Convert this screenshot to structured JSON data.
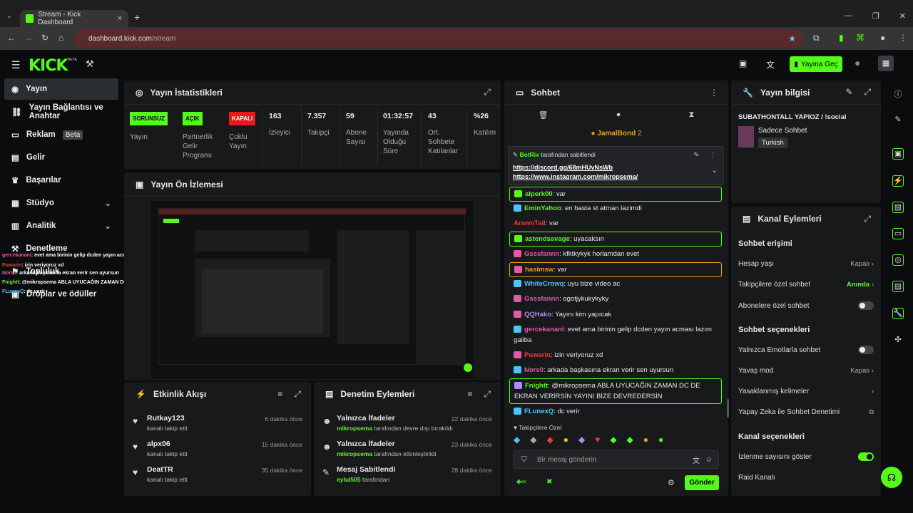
{
  "browser": {
    "tab_title": "Stream - Kick Dashboard",
    "url_host": "dashboard.kick.com",
    "url_path": "/stream"
  },
  "topbar": {
    "logo": "KICK",
    "beta": "BETA",
    "go_live": "Yayına Geç"
  },
  "sidebar": {
    "items": [
      {
        "label": "Yayın"
      },
      {
        "label": "Yayın Bağlantısı ve Anahtar"
      },
      {
        "label": "Reklam",
        "badge": "Beta"
      },
      {
        "label": "Gelir"
      },
      {
        "label": "Başarılar"
      },
      {
        "label": "Stüdyo"
      },
      {
        "label": "Analitik"
      },
      {
        "label": "Denetleme"
      },
      {
        "label": "Topluluk"
      },
      {
        "label": "Droplar ve ödüller"
      }
    ],
    "overlay_chat": [
      {
        "user": "gercekanani",
        "text": ": evet ama birinin gelip dcden yayın acması lazım galiba"
      },
      {
        "user": "Puwarin",
        "text": ": izin veriyoruz xd"
      },
      {
        "user": "Nors0",
        "text": ": arkada başkasına ekran verir sen uyursun"
      },
      {
        "user": "Fnightt",
        "text": ": @mikropsema ABLA UYUCAĞIN ZAMAN DC DE EKRAN VERİRSİN YAYINI BİZE DEVREDERSİN"
      },
      {
        "user": "FLunexQ",
        "text": ": dc verir"
      }
    ]
  },
  "stats": {
    "title": "Yayın İstatistikleri",
    "items": [
      {
        "pill": "SORUNSUZ",
        "label": "Yayın"
      },
      {
        "pill": "AÇIK",
        "label": "Partnerlik Gelir Programı"
      },
      {
        "pill": "KAPALI",
        "label": "Çoklu Yayın"
      },
      {
        "value": "163",
        "label": "İzleyici"
      },
      {
        "value": "7.357",
        "label": "Takipçi"
      },
      {
        "value": "59",
        "label": "Abone Sayısı"
      },
      {
        "value": "01:32:57",
        "label": "Yayında Olduğu Süre"
      },
      {
        "value": "43",
        "label": "Ort. Sohbete Katılanlar"
      },
      {
        "value": "%26",
        "label": "Katılım"
      }
    ]
  },
  "preview": {
    "title": "Yayın Ön İzlemesi"
  },
  "activity": {
    "title": "Etkinlik Akışı",
    "items": [
      {
        "name": "Rutkay123",
        "sub": "kanalı takip etti",
        "time": "6 dakika önce"
      },
      {
        "name": "alpx06",
        "sub": "kanalı takip etti",
        "time": "15 dakika önce"
      },
      {
        "name": "DeatTR",
        "sub": "kanalı takip etti",
        "time": "35 dakika önce"
      }
    ]
  },
  "moderation": {
    "title": "Denetim Eylemleri",
    "items": [
      {
        "name": "Yalnızca İfadeler",
        "actor": "mikropsema",
        "sub": " tarafından devre dışı bırakıldı",
        "time": "22 dakika önce"
      },
      {
        "name": "Yalnızca İfadeler",
        "actor": "mikropsema",
        "sub": " tarafından etkinleştirildi",
        "time": "23 dakika önce"
      },
      {
        "name": "Mesaj Sabitlendi",
        "actor": "eylul505",
        "sub": " tarafından",
        "time": "28 dakika önce"
      }
    ]
  },
  "chat": {
    "title": "Sohbet",
    "top_gifter": "JamalBond",
    "top_gifter_count": "2",
    "pinned_by": "BotRix",
    "pinned_suffix": "tarafından sabitlendi",
    "pinned_links": [
      "https://discord.gg/68mHUvNsWb",
      "https://www.instagram.com/mikropsema/"
    ],
    "messages": [
      {
        "user": "alperk00",
        "text": ": var",
        "color": "#53fc18"
      },
      {
        "user": "EminYahoo",
        "text": ": en basta st atman lazimdi",
        "color": "#53fc18"
      },
      {
        "user": "ArawnTail",
        "text": ": var",
        "color": "#e93c3c"
      },
      {
        "user": "astendsavage",
        "text": ": uyacaksın",
        "color": "#53fc18"
      },
      {
        "user": "Gsssfannn",
        "text": ": kfktkykyk horlamdan evet",
        "color": "#e05aa8"
      },
      {
        "user": "hasimsw",
        "text": ": var",
        "color": "#e8a01a"
      },
      {
        "user": "WhiteCrowq",
        "text": ": uyu bize video ac",
        "color": "#4fc3f7"
      },
      {
        "user": "Gsssfannn",
        "text": ": ogotjykukykyky",
        "color": "#e05aa8"
      },
      {
        "user": "QQHako",
        "text": ": Yayını kim yapıcak",
        "color": "#b388ff"
      },
      {
        "user": "gercekanani",
        "text": ": evet ama birinin gelip dcden yayın acması lazım galiba",
        "color": "#e05aa8"
      },
      {
        "user": "Puwarin",
        "text": ": izin veriyoruz xd",
        "color": "#e93c3c"
      },
      {
        "user": "Nors0",
        "text": ": arkada başkasına ekran verir sen uyursun",
        "color": "#e05aa8"
      },
      {
        "user": "Fnightt",
        "text": ": @mikropsema ABLA UYUCAĞIN ZAMAN DC DE EKRAN VERİRSİN YAYINI BİZE DEVREDERSİN",
        "color": "#53fc18"
      },
      {
        "user": "FLunexQ",
        "text": ": dc verir",
        "color": "#4fc3f7"
      }
    ],
    "followers_only": "Takipçilere Özel",
    "input_placeholder": "Bir mesaj gönderin",
    "send": "Gönder"
  },
  "stream_info": {
    "title": "Yayın bilgisi",
    "stream_title": "SUBATHONTALL YAPIOZ / !social",
    "category": "Sadece Sohbet",
    "language": "Turkish"
  },
  "channel_actions": {
    "title": "Kanal Eylemleri",
    "chat_access": "Sohbet erişimi",
    "account_age": "Hesap yaşı",
    "account_age_val": "Kapalı",
    "followers_chat": "Takipçilere özel sohbet",
    "followers_chat_val": "Anında",
    "subs_chat": "Abonelere özel sohbet",
    "chat_options": "Sohbet seçenekleri",
    "emote_only": "Yalnızca Emotlarla sohbet",
    "slow_mode": "Yavaş mod",
    "slow_mode_val": "Kapalı",
    "banned_words": "Yasaklanmış kelimeler",
    "ai_mod": "Yapay Zeka ile Sohbet Denetimi",
    "channel_options": "Kanal seçenekleri",
    "show_viewers": "İzlenme sayısını göster",
    "raid": "Raid Kanalı"
  }
}
